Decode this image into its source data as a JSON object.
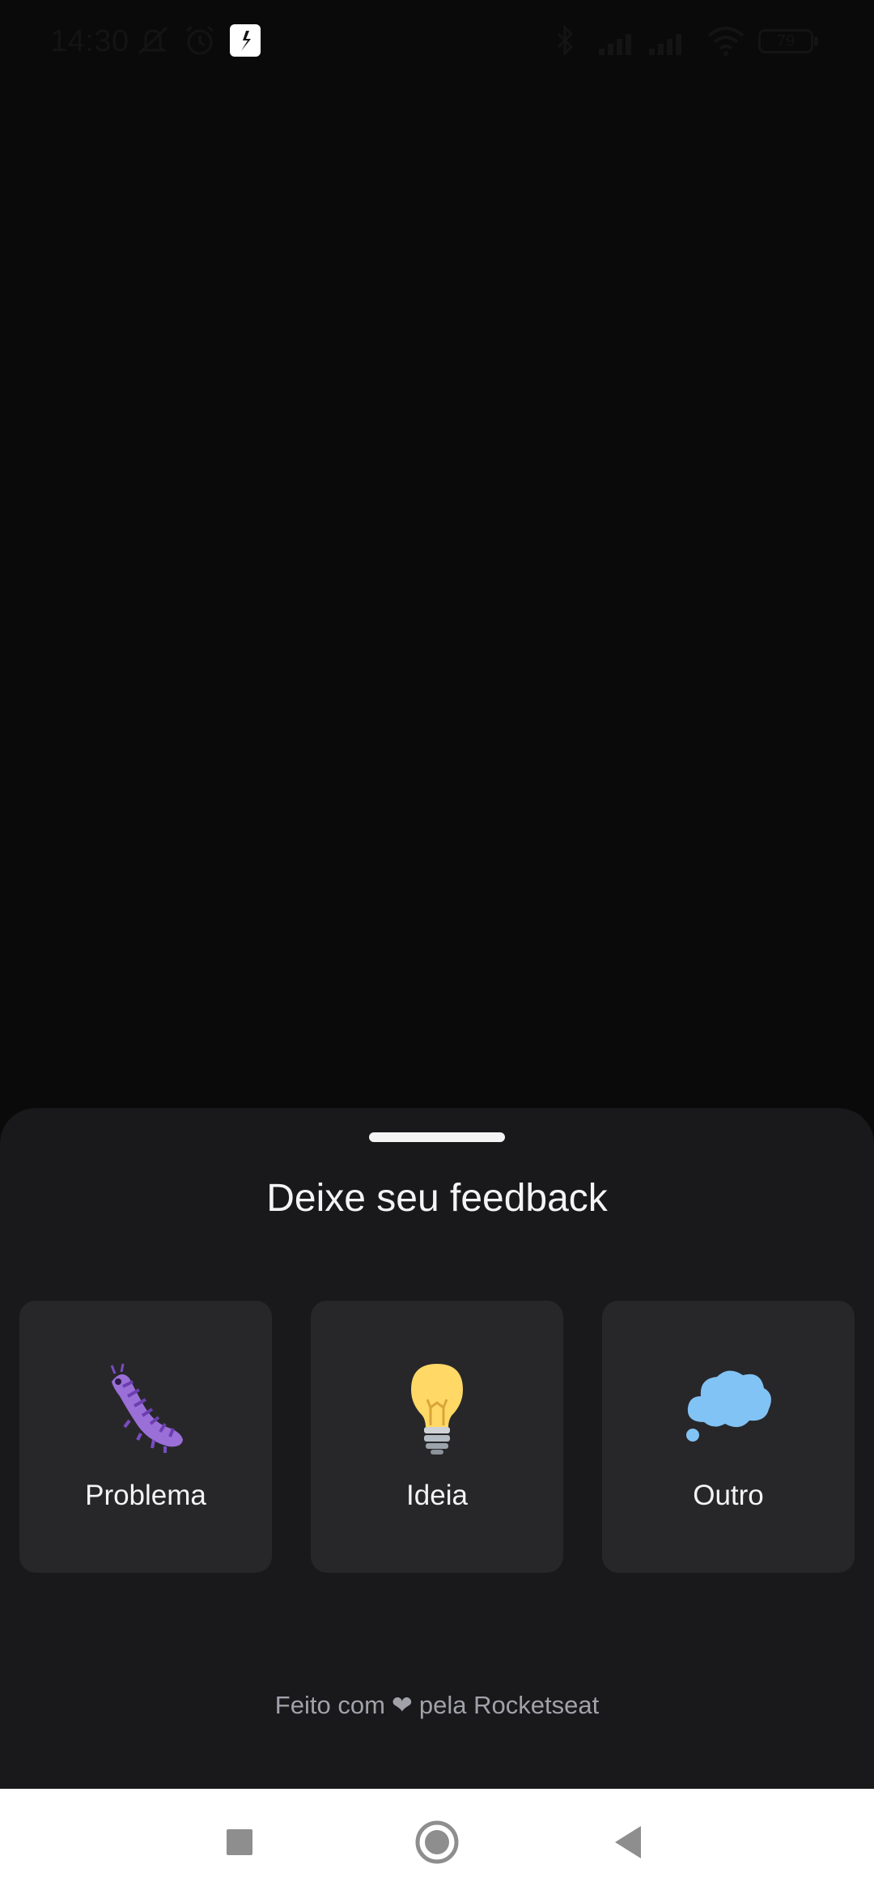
{
  "status_bar": {
    "time": "14:30",
    "battery": "79",
    "icons": [
      "mute-icon",
      "alarm-icon",
      "app-notification-icon",
      "bluetooth-icon",
      "signal-icon",
      "wifi-icon",
      "battery-icon"
    ]
  },
  "sheet": {
    "title": "Deixe seu feedback",
    "options": [
      {
        "label": "Problema",
        "icon": "bug-icon"
      },
      {
        "label": "Ideia",
        "icon": "lightbulb-icon"
      },
      {
        "label": "Outro",
        "icon": "thought-bubble-icon"
      }
    ],
    "footer_prefix": "Feito com",
    "footer_suffix": "pela Rocketseat",
    "footer_icon": "heart-icon"
  },
  "nav_bar": {
    "buttons": [
      "recents-button",
      "home-button",
      "back-button"
    ]
  },
  "colors": {
    "background": "#0a0a0b",
    "sheet": "#19191b",
    "card": "#27272a",
    "text": "#f4f4f5",
    "muted": "#a1a1aa"
  }
}
